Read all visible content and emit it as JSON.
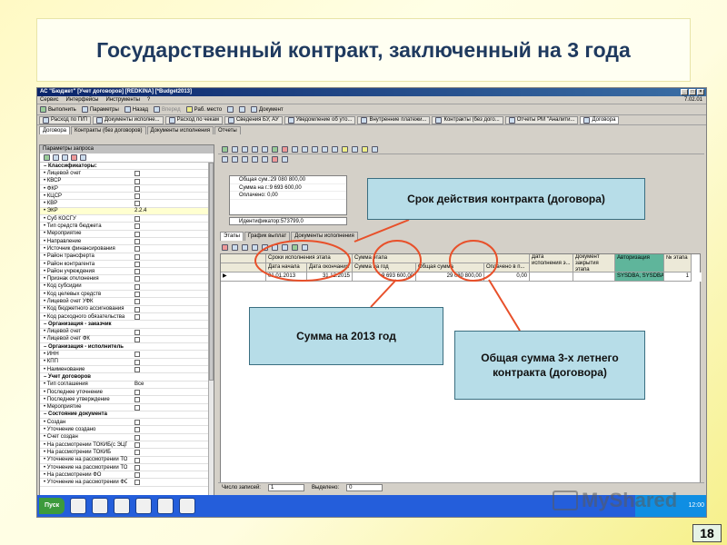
{
  "slide": {
    "title": "Государственный контракт, заключенный на 3 года",
    "page_number": "18"
  },
  "app": {
    "title": "АС \"Бюджет\" [Учет договоров] [REDKINA] [*Budget2013]",
    "version": "7.02.01",
    "menu": [
      "Сервис",
      "Интерфейсы",
      "Инструменты",
      "?"
    ],
    "toolbar": [
      "Выполнить",
      "Параметры",
      "Назад",
      "Вперед",
      "Раб. место",
      "Документ"
    ],
    "doc_tabs": [
      "Расход по П/П",
      "Документы исполне...",
      "Расход по чекам",
      "Сведения БУ, АУ",
      "Уведомление об уто...",
      "Внутренние платежи...",
      "Контракты (без дого...",
      "Отчеты РМ \"Аналити...",
      "Договора"
    ],
    "module_tabs": [
      "Договора",
      "Контракты (без договоров)",
      "Документы исполнения",
      "Отчеты"
    ]
  },
  "left_panel": {
    "title": "Параметры запроса",
    "rows": [
      {
        "label": "Классификаторы:",
        "type": "header"
      },
      {
        "label": "Лицевой счет",
        "type": "item"
      },
      {
        "label": "КВСР",
        "type": "item"
      },
      {
        "label": "ФКР",
        "type": "item"
      },
      {
        "label": "КЦСР",
        "type": "item"
      },
      {
        "label": "КВР",
        "type": "item"
      },
      {
        "label": "ЭКР",
        "type": "item",
        "value": "2.2.4"
      },
      {
        "label": "Суб КОСГУ",
        "type": "item"
      },
      {
        "label": "Тип средств бюджета",
        "type": "item"
      },
      {
        "label": "Мероприятие",
        "type": "item"
      },
      {
        "label": "Направление",
        "type": "item"
      },
      {
        "label": "Источник финансирования",
        "type": "item"
      },
      {
        "label": "Район трансферта",
        "type": "item"
      },
      {
        "label": "Район контрагента",
        "type": "item"
      },
      {
        "label": "Район учреждения",
        "type": "item"
      },
      {
        "label": "Признак отклонения",
        "type": "item"
      },
      {
        "label": "Код субсидии",
        "type": "item"
      },
      {
        "label": "Код целевых средств",
        "type": "item"
      },
      {
        "label": "Лицевой счет УФК",
        "type": "item"
      },
      {
        "label": "Код бюджетного ассигнования",
        "type": "item"
      },
      {
        "label": "Код расходного обязательства",
        "type": "item"
      },
      {
        "label": "Организация - заказчик",
        "type": "header"
      },
      {
        "label": "Лицевой счет",
        "type": "item"
      },
      {
        "label": "Лицевой счет ФК",
        "type": "item"
      },
      {
        "label": "Организация - исполнитель",
        "type": "header"
      },
      {
        "label": "ИНН",
        "type": "item"
      },
      {
        "label": "КПП",
        "type": "item"
      },
      {
        "label": "Наименование",
        "type": "item"
      },
      {
        "label": "Учет договоров",
        "type": "header"
      },
      {
        "label": "Тип соглашения",
        "type": "item",
        "value": "Все"
      },
      {
        "label": "Последнее уточнение",
        "type": "item"
      },
      {
        "label": "Последнее утверждение",
        "type": "item"
      },
      {
        "label": "Мероприятие",
        "type": "item"
      },
      {
        "label": "Состояние документа",
        "type": "header"
      },
      {
        "label": "Создан",
        "type": "item"
      },
      {
        "label": "Уточнение создано",
        "type": "item"
      },
      {
        "label": "Счет создан",
        "type": "item"
      },
      {
        "label": "На рассмотрении ТОКИБ(с ЭЦП)",
        "type": "item"
      },
      {
        "label": "На рассмотрении ТОКИБ",
        "type": "item"
      },
      {
        "label": "Уточнение на рассмотрении ТОК",
        "type": "item"
      },
      {
        "label": "Уточнение на рассмотрении ТОК",
        "type": "item"
      },
      {
        "label": "На рассмотрении ФО",
        "type": "item"
      },
      {
        "label": "Уточнение на рассмотрении ФО",
        "type": "item"
      }
    ]
  },
  "summary": {
    "rows": [
      "Общая сум.:29 080 800,00",
      "Сумма на г.:9 693 600,00",
      "Оплачено: 0,00"
    ],
    "identifier": "Идентификатор:573799,0"
  },
  "sub_tabs": [
    "Этапы",
    "График выплат",
    "Документы исполнения"
  ],
  "grid": {
    "group_headers": [
      "Сроки исполнения этапа",
      "Сумма этапа"
    ],
    "headers": [
      "Дата начала",
      "Дата окончания",
      "Сумма на год",
      "Общая сумма",
      "Оплачено в п...",
      "Дата исполнения э...",
      "Документ закрытия этапа",
      "Авторизация",
      "№ этапа"
    ],
    "rows": [
      {
        "start": "01.01.2013",
        "end": "31.12.2015",
        "year_sum": "9 693 600,00",
        "total_sum": "29 080 800,00",
        "paid": "0,00",
        "exec_date": "",
        "close_doc": "",
        "auth": "SYSDBA, SYSDBA",
        "stage": "1"
      }
    ]
  },
  "status_bar": {
    "records_label": "Число записей:",
    "records_value": "1",
    "selected_label": "Выделено:",
    "selected_value": "0"
  },
  "taskbar": {
    "start": "Пуск",
    "tray_time": "12:00"
  },
  "callouts": {
    "contract_period": "Срок действия контракта (договора)",
    "year_sum": "Сумма на 2013 год",
    "total_sum": "Общая сумма 3-х летнего контракта (договора)"
  },
  "watermark": "MyShared",
  "colors": {
    "title_text": "#1f3a5f",
    "callout_fill": "#b7dde8",
    "ellipse_stroke": "#e8502a",
    "auth_cell": "#5fb59b"
  }
}
